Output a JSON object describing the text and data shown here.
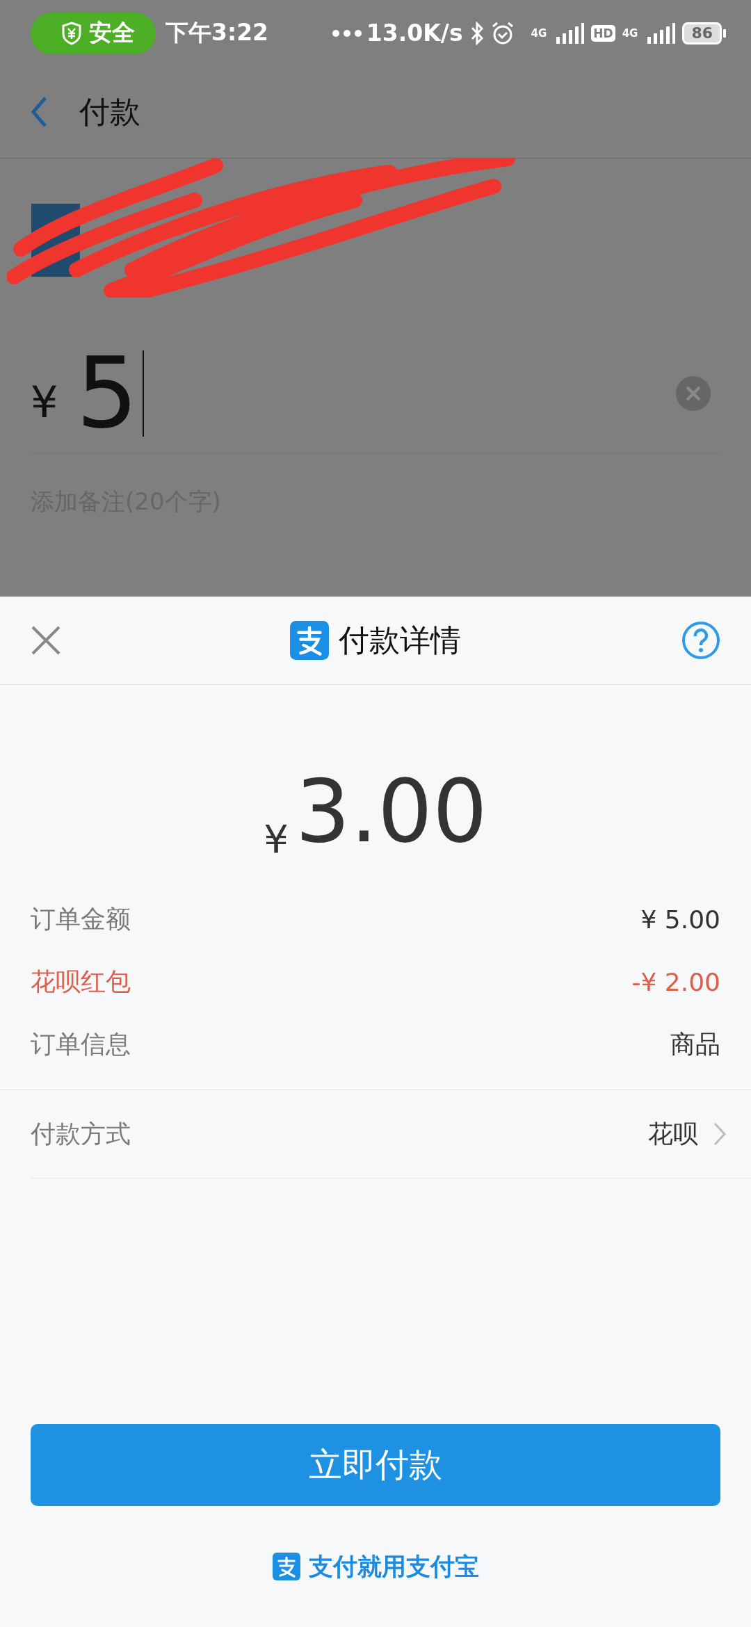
{
  "status_bar": {
    "security_label": "安全",
    "time": "下午3:22",
    "net_speed": "13.0K/s",
    "network_1": "4G",
    "hd": "HD",
    "network_2": "4G",
    "battery": "86"
  },
  "nav": {
    "title": "付款"
  },
  "amount_input": {
    "currency": "¥",
    "value": "5"
  },
  "note_field": {
    "placeholder": "添加备注(20个字)"
  },
  "sheet": {
    "title": "付款详情",
    "amount_currency": "¥",
    "amount": "3.00",
    "rows": [
      {
        "label": "订单金额",
        "value": "¥ 5.00",
        "kind": "normal"
      },
      {
        "label": "花呗红包",
        "value": "-¥ 2.00",
        "kind": "discount"
      },
      {
        "label": "订单信息",
        "value": "商品",
        "kind": "normal"
      }
    ],
    "payment_method": {
      "label": "付款方式",
      "value": "花呗"
    },
    "pay_button": "立即付款",
    "footer": "支付就用支付宝"
  }
}
